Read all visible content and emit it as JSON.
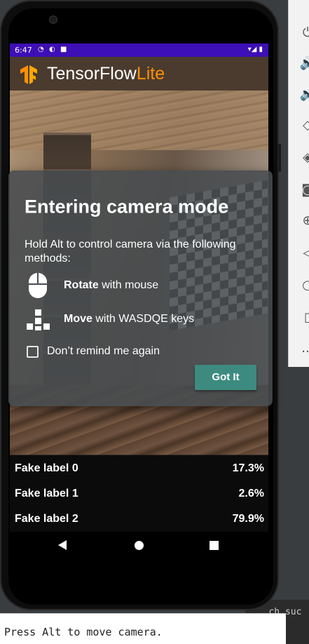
{
  "status": {
    "time": "6:47"
  },
  "app": {
    "title_main": "TensorFlow",
    "title_accent": "Lite"
  },
  "dialog": {
    "title": "Entering camera mode",
    "body": "Hold Alt to control camera via the following methods:",
    "rotate_bold": "Rotate",
    "rotate_rest": " with mouse",
    "move_bold": "Move",
    "move_rest": " with WASDQE keys",
    "checkbox_label": "Don’t remind me again",
    "button": "Got It"
  },
  "results": [
    {
      "label": "Fake label 0",
      "value": "17.3%"
    },
    {
      "label": "Fake label 1",
      "value": "2.6%"
    },
    {
      "label": "Fake label 2",
      "value": "79.9%"
    }
  ],
  "bottom": {
    "hint": "Press Alt to move camera."
  },
  "side_snippet": "...ch suc",
  "colors": {
    "status_bar": "#3d0fb6",
    "accent": "#ff8f00",
    "button": "#3d8b80"
  }
}
